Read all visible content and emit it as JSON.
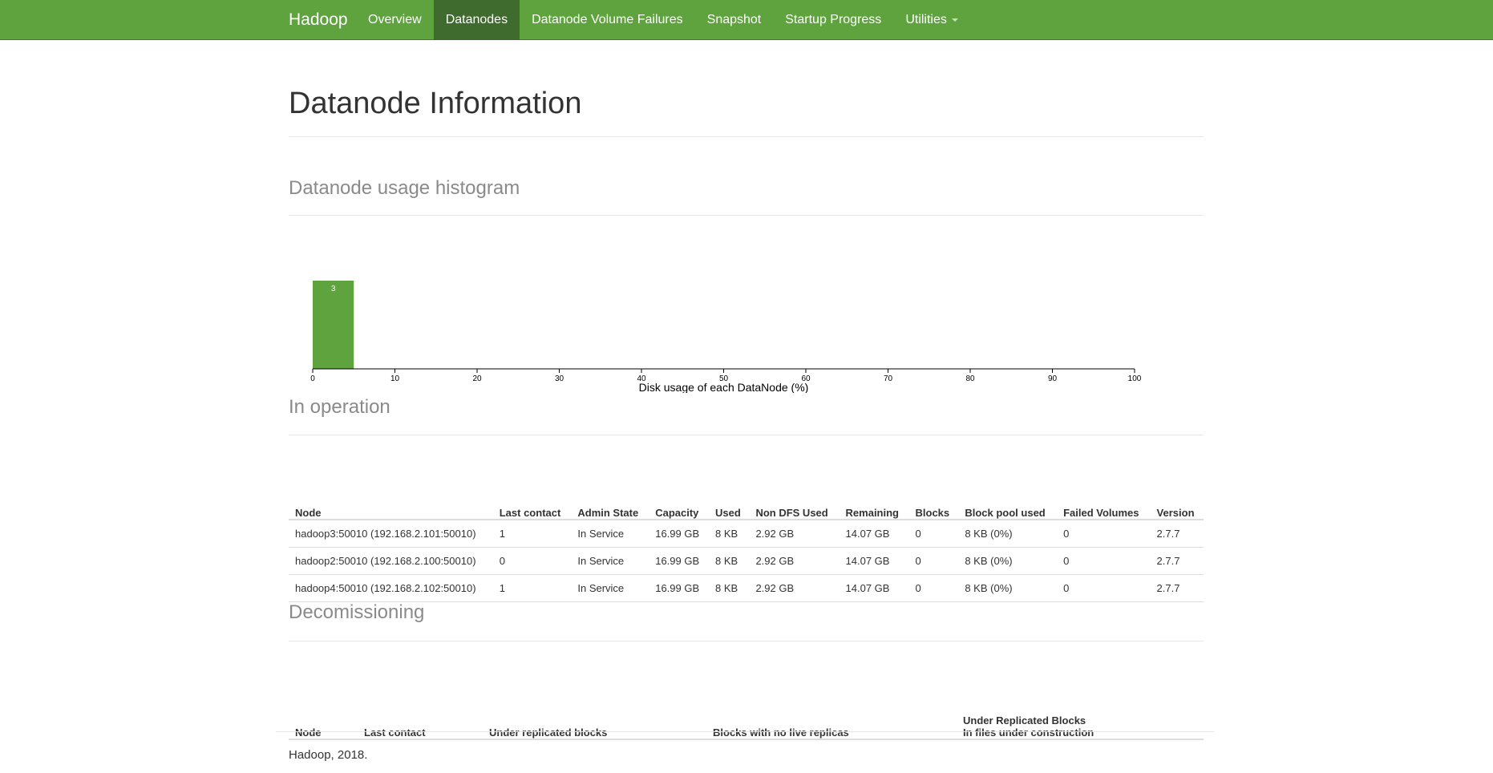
{
  "navbar": {
    "brand": "Hadoop",
    "items": [
      {
        "label": "Overview",
        "active": false
      },
      {
        "label": "Datanodes",
        "active": true
      },
      {
        "label": "Datanode Volume Failures",
        "active": false
      },
      {
        "label": "Snapshot",
        "active": false
      },
      {
        "label": "Startup Progress",
        "active": false
      },
      {
        "label": "Utilities",
        "active": false,
        "dropdown": true
      }
    ]
  },
  "page": {
    "title": "Datanode Information",
    "histogram_title": "Datanode usage histogram",
    "in_operation_title": "In operation",
    "decommissioning_title": "Decomissioning"
  },
  "chart_data": {
    "type": "bar",
    "xlabel": "Disk usage of each DataNode (%)",
    "xlim": [
      0,
      100
    ],
    "xticks": [
      "0",
      "10",
      "20",
      "30",
      "40",
      "50",
      "60",
      "70",
      "80",
      "90",
      "100"
    ],
    "bins": [
      {
        "x0": 0,
        "x1": 5,
        "count": 3
      }
    ],
    "bar_color": "#5fa33e"
  },
  "in_operation": {
    "columns": [
      "Node",
      "Last contact",
      "Admin State",
      "Capacity",
      "Used",
      "Non DFS Used",
      "Remaining",
      "Blocks",
      "Block pool used",
      "Failed Volumes",
      "Version"
    ],
    "rows": [
      [
        "hadoop3:50010 (192.168.2.101:50010)",
        "1",
        "In Service",
        "16.99 GB",
        "8 KB",
        "2.92 GB",
        "14.07 GB",
        "0",
        "8 KB (0%)",
        "0",
        "2.7.7"
      ],
      [
        "hadoop2:50010 (192.168.2.100:50010)",
        "0",
        "In Service",
        "16.99 GB",
        "8 KB",
        "2.92 GB",
        "14.07 GB",
        "0",
        "8 KB (0%)",
        "0",
        "2.7.7"
      ],
      [
        "hadoop4:50010 (192.168.2.102:50010)",
        "1",
        "In Service",
        "16.99 GB",
        "8 KB",
        "2.92 GB",
        "14.07 GB",
        "0",
        "8 KB (0%)",
        "0",
        "2.7.7"
      ]
    ]
  },
  "decommissioning": {
    "columns": [
      "Node",
      "Last contact",
      "Under replicated blocks",
      "Blocks with no live replicas"
    ],
    "last_column_line1": "Under Replicated Blocks",
    "last_column_line2": "In files under construction"
  },
  "footer": "Hadoop, 2018."
}
